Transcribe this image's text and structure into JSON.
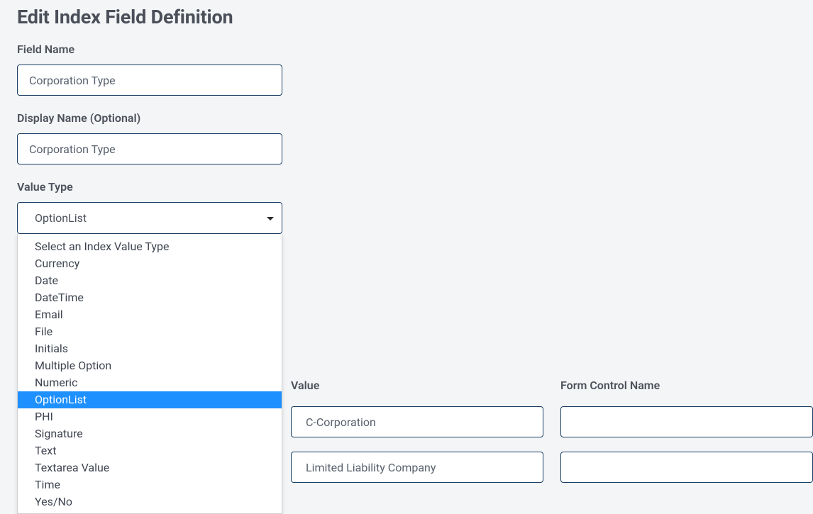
{
  "title": "Edit Index Field Definition",
  "fields": {
    "fieldName": {
      "label": "Field Name",
      "value": "Corporation Type"
    },
    "displayName": {
      "label": "Display Name (Optional)",
      "value": "Corporation Type"
    },
    "valueType": {
      "label": "Value Type",
      "selected": "OptionList"
    }
  },
  "valueTypeOptions": [
    "Select an Index Value Type",
    "Currency",
    "Date",
    "DateTime",
    "Email",
    "File",
    "Initials",
    "Multiple Option",
    "Numeric",
    "OptionList",
    "PHI",
    "Signature",
    "Text",
    "Textarea Value",
    "Time",
    "Yes/No"
  ],
  "tableHeaders": {
    "value": "Value",
    "formControlName": "Form Control Name"
  },
  "rows": [
    {
      "value": "C-Corporation",
      "control": ""
    },
    {
      "value": "Limited Liability Company",
      "control": ""
    }
  ]
}
